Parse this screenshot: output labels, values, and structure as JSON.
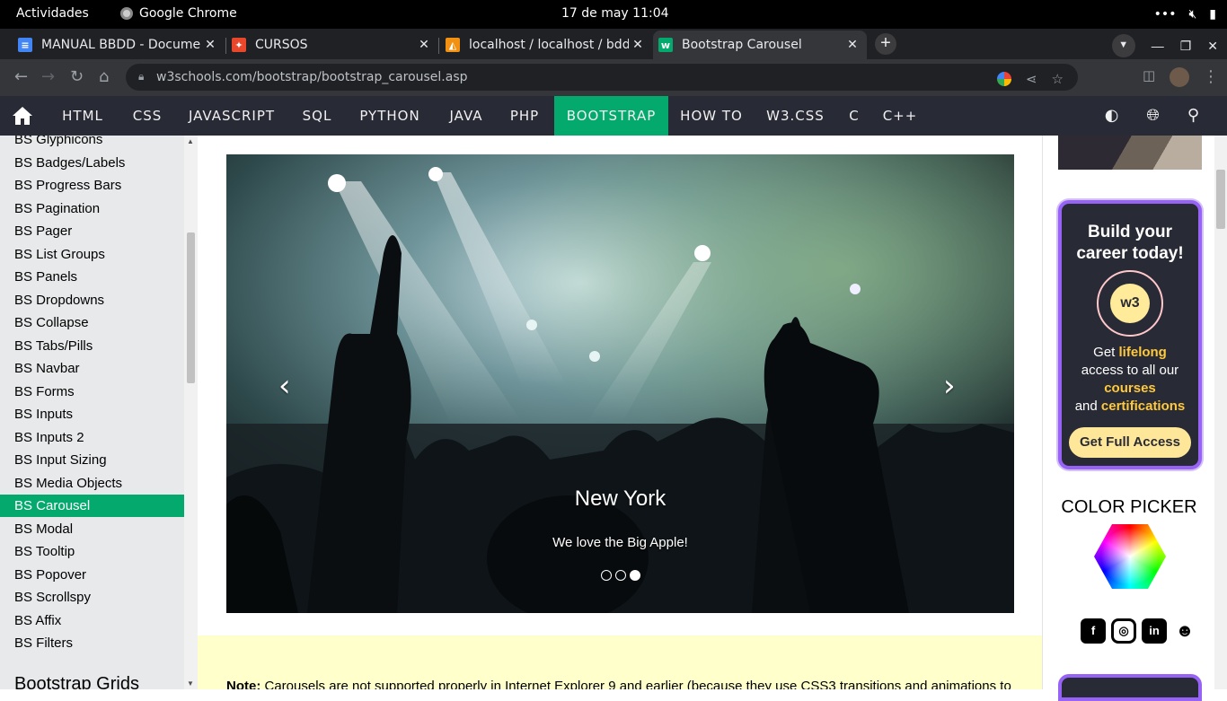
{
  "system_bar": {
    "activities": "Actividades",
    "app_name": "Google Chrome",
    "clock": "17 de may  11:04"
  },
  "browser": {
    "tabs": [
      {
        "title": "MANUAL BBDD - Documen",
        "favicon": "docs-icon",
        "color": "#4285f4",
        "active": false
      },
      {
        "title": "CURSOS",
        "favicon": "cursos-icon",
        "color": "#e8472c",
        "active": false
      },
      {
        "title": "localhost / localhost / bdd",
        "favicon": "phpmyadmin-icon",
        "color": "#f29111",
        "active": false
      },
      {
        "title": "Bootstrap Carousel",
        "favicon": "w3schools-icon",
        "color": "#04aa6d",
        "active": true
      }
    ],
    "url": "w3schools.com/bootstrap/bootstrap_carousel.asp"
  },
  "w3nav": {
    "items": [
      "HTML",
      "CSS",
      "JAVASCRIPT",
      "SQL",
      "PYTHON",
      "JAVA",
      "PHP",
      "BOOTSTRAP",
      "HOW TO",
      "W3.CSS",
      "C",
      "C++"
    ],
    "active": "BOOTSTRAP",
    "accent": "#04aa6d"
  },
  "sidebar": {
    "items": [
      "BS Glyphicons",
      "BS Badges/Labels",
      "BS Progress Bars",
      "BS Pagination",
      "BS Pager",
      "BS List Groups",
      "BS Panels",
      "BS Dropdowns",
      "BS Collapse",
      "BS Tabs/Pills",
      "BS Navbar",
      "BS Forms",
      "BS Inputs",
      "BS Inputs 2",
      "BS Input Sizing",
      "BS Media Objects",
      "BS Carousel",
      "BS Modal",
      "BS Tooltip",
      "BS Popover",
      "BS Scrollspy",
      "BS Affix",
      "BS Filters"
    ],
    "active": "BS Carousel",
    "heading": "Bootstrap Grids"
  },
  "carousel": {
    "caption_title": "New York",
    "caption_text": "We love the Big Apple!",
    "slides": 3,
    "active_slide": 3
  },
  "note": {
    "label": "Note:",
    "text": " Carousels are not supported properly in Internet Explorer 9 and earlier (because they use CSS3 transitions and animations to"
  },
  "promo": {
    "line1": "Build your",
    "line2": "career today!",
    "badge": "w3",
    "text_get": "Get ",
    "text_lifelong": "lifelong",
    "text_access": "access to all our",
    "text_courses": "courses",
    "text_and": "and ",
    "text_certifications": "certifications",
    "cta": "Get Full Access"
  },
  "color_picker": {
    "title": "COLOR PICKER"
  }
}
